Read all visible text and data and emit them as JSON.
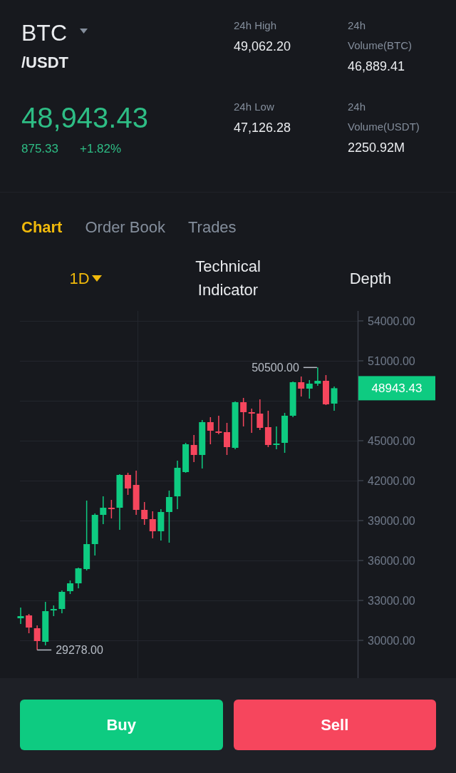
{
  "pair": {
    "base": "BTC",
    "quote": "/USDT"
  },
  "price": {
    "last": "48,943.43",
    "change": "875.33",
    "change_percent": "+1.82%"
  },
  "stats": [
    {
      "label": "24h High",
      "value": "49,062.20"
    },
    {
      "label": "24h Volume(BTC)",
      "value": "46,889.41"
    },
    {
      "label": "24h Low",
      "value": "47,126.28"
    },
    {
      "label": "24h Volume(USDT)",
      "value": "2250.92M"
    }
  ],
  "tabs": [
    {
      "label": "Chart",
      "selected": true
    },
    {
      "label": "Order Book",
      "selected": false
    },
    {
      "label": "Trades",
      "selected": false
    }
  ],
  "chart_toolbar": [
    {
      "label": "1D",
      "kind": "dropdown",
      "selected": true
    },
    {
      "label": "Technical Indicator",
      "kind": "button",
      "selected": false
    },
    {
      "label": "Depth",
      "kind": "button",
      "selected": false
    }
  ],
  "price_chart": {
    "high_marker": "50500.00",
    "last_price_tag": "48943.43",
    "low_marker": "29278.00",
    "chart_data": {
      "type": "candlestick",
      "ohlc": [
        [
          31661,
          32464,
          31232,
          31821
        ],
        [
          31875,
          31982,
          30536,
          30964
        ],
        [
          30911,
          31125,
          29278,
          29946
        ],
        [
          29893,
          32893,
          29625,
          32196
        ],
        [
          32250,
          32625,
          31821,
          32357
        ],
        [
          32357,
          33750,
          32036,
          33643
        ],
        [
          33696,
          34500,
          33482,
          34286
        ],
        [
          34286,
          35464,
          33911,
          35411
        ],
        [
          35357,
          40500,
          35250,
          37232
        ],
        [
          37232,
          39536,
          36375,
          39429
        ],
        [
          39429,
          40821,
          38732,
          39964
        ],
        [
          39964,
          40554,
          39161,
          39857
        ],
        [
          39964,
          42482,
          38304,
          42429
        ],
        [
          42429,
          42589,
          40929,
          41411
        ],
        [
          41679,
          42750,
          39429,
          39804
        ],
        [
          39804,
          40393,
          38679,
          39107
        ],
        [
          39107,
          39696,
          37661,
          38196
        ],
        [
          38196,
          39857,
          37500,
          39643
        ],
        [
          39643,
          41250,
          37339,
          40768
        ],
        [
          40821,
          43500,
          39857,
          42964
        ],
        [
          42643,
          44839,
          42589,
          44732
        ],
        [
          44679,
          45429,
          43393,
          43929
        ],
        [
          43929,
          46554,
          42911,
          46393
        ],
        [
          46393,
          46768,
          44732,
          45750
        ],
        [
          45696,
          46875,
          45482,
          45589
        ],
        [
          45643,
          46339,
          43929,
          44518
        ],
        [
          44464,
          47946,
          44357,
          47893
        ],
        [
          47893,
          48214,
          46071,
          47143
        ],
        [
          47143,
          47411,
          45589,
          47036
        ],
        [
          47036,
          48107,
          45804,
          45964
        ],
        [
          46018,
          47250,
          44518,
          44679
        ],
        [
          44732,
          46071,
          44357,
          44786
        ],
        [
          44839,
          47089,
          44089,
          46875
        ],
        [
          46875,
          49446,
          46768,
          49393
        ],
        [
          49393,
          49821,
          48321,
          48911
        ],
        [
          48911,
          49554,
          48161,
          49286
        ],
        [
          49286,
          50500,
          49125,
          49500
        ],
        [
          49500,
          49929,
          47679,
          47732
        ],
        [
          47786,
          49071,
          47250,
          48943.43
        ]
      ],
      "ylim": [
        27161,
        54750
      ],
      "yticks": [
        {
          "value": 54000,
          "label": "54000.00"
        },
        {
          "value": 51000,
          "label": "51000.00"
        },
        {
          "value": 45000,
          "label": "45000.00"
        },
        {
          "value": 42000,
          "label": "42000.00"
        },
        {
          "value": 39000,
          "label": "39000.00"
        },
        {
          "value": 36000,
          "label": "36000.00"
        },
        {
          "value": 33000,
          "label": "33000.00"
        },
        {
          "value": 30000,
          "label": "30000.00"
        }
      ],
      "grid": true
    }
  },
  "actions": [
    {
      "label": "Buy",
      "kind": "buy"
    },
    {
      "label": "Sell",
      "kind": "sell"
    }
  ]
}
